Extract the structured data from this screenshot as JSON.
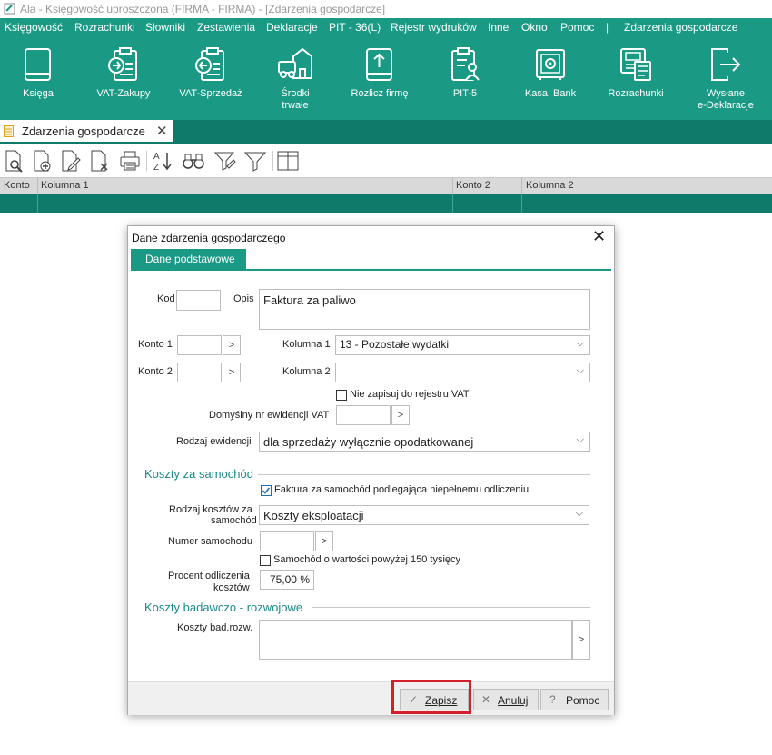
{
  "window": {
    "title": "Ala - Księgowość uproszczona (FIRMA - FIRMA) - [Zdarzenia gospodarcze]"
  },
  "menu": {
    "items": [
      "Księgowość",
      "Rozrachunki",
      "Słowniki",
      "Zestawienia",
      "Deklaracje",
      "PIT - 36(L)",
      "Rejestr wydruków",
      "Inne",
      "Okno",
      "Pomoc",
      "|",
      "Zdarzenia gospodarcze"
    ]
  },
  "ribbon": {
    "buttons": [
      {
        "label": "Księga",
        "icon": "book-icon"
      },
      {
        "label": "VAT-Zakupy",
        "icon": "clipboard-in-icon"
      },
      {
        "label": "VAT-Sprzedaż",
        "icon": "clipboard-out-icon"
      },
      {
        "label": "Środki\ntrwałe",
        "icon": "assets-icon"
      },
      {
        "label": "Rozlicz firmę",
        "icon": "upload-book-icon"
      },
      {
        "label": "PIT-5",
        "icon": "tax-form-icon"
      },
      {
        "label": "Kasa, Bank",
        "icon": "safe-icon"
      },
      {
        "label": "Rozrachunki",
        "icon": "settlements-icon"
      },
      {
        "label": "Wysłane\ne-Deklaracje",
        "icon": "sent-declarations-icon"
      }
    ]
  },
  "doc_tab": {
    "label": "Zdarzenia gospodarcze",
    "close": "✕"
  },
  "grid": {
    "columns": [
      "Konto",
      "Kolumna 1",
      "Konto 2",
      "Kolumna 2"
    ]
  },
  "dialog": {
    "title": "Dane zdarzenia gospodarczego",
    "close": "✕",
    "tab": "Dane podstawowe",
    "kod_label": "Kod",
    "kod_value": "",
    "opis_label": "Opis",
    "opis_value": "Faktura za paliwo",
    "konto1_label": "Konto 1",
    "konto2_label": "Konto 2",
    "kolumna1_label": "Kolumna 1",
    "kolumna1_value": "13 - Pozostałe wydatki",
    "kolumna2_label": "Kolumna 2",
    "kolumna2_value": "",
    "nie_zapisuj_label": "Nie zapisuj do rejestru VAT",
    "nie_zapisuj_checked": false,
    "domyslny_nr_label": "Domyślny nr ewidencji VAT",
    "rodzaj_ewidencji_label": "Rodzaj ewidencji",
    "rodzaj_ewidencji_value": "dla sprzedaży wyłącznie opodatkowanej",
    "section_koszty_samochod": "Koszty za samochód",
    "faktura_samochod_label": "Faktura za samochód podlegająca niepełnemu odliczeniu",
    "faktura_samochod_checked": true,
    "rodzaj_kosztow_label_1": "Rodzaj kosztów za",
    "rodzaj_kosztow_label_2": "samochód",
    "rodzaj_kosztow_value": "Koszty eksploatacji",
    "numer_samochodu_label": "Numer samochodu",
    "samochod_150_label": "Samochód o wartości powyżej 150 tysięcy",
    "samochod_150_checked": false,
    "procent_label_1": "Procent odliczenia",
    "procent_label_2": "kosztów",
    "procent_value": "75,00 %",
    "section_koszty_br": "Koszty badawczo - rozwojowe",
    "koszty_br_label": "Koszty bad.rozw.",
    "buttons": {
      "zapisz": "Zapisz",
      "anuluj": "Anuluj",
      "pomoc": "Pomoc"
    }
  }
}
